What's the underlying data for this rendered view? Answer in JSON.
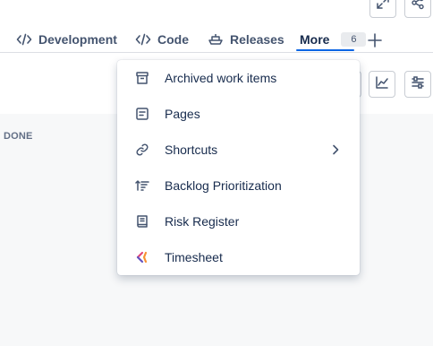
{
  "header": {
    "expand_icon": "expand-icon",
    "share_icon": "share-icon"
  },
  "tabs": [
    {
      "label": "Development",
      "icon": "code-slash-icon"
    },
    {
      "label": "Code",
      "icon": "code-slash-icon"
    },
    {
      "label": "Releases",
      "icon": "ship-icon"
    },
    {
      "label": "More",
      "badge": "6",
      "active": true
    }
  ],
  "add_tab_icon": "plus-icon",
  "toolbar": {
    "chart_icon": "line-chart-icon",
    "settings_icon": "sliders-icon"
  },
  "board": {
    "column_title": "DONE"
  },
  "menu": {
    "items": [
      {
        "label": "Archived work items",
        "icon": "archive-icon"
      },
      {
        "label": "Pages",
        "icon": "page-icon"
      },
      {
        "label": "Shortcuts",
        "icon": "link-icon",
        "has_submenu": true
      },
      {
        "label": "Backlog Prioritization",
        "icon": "sort-priority-icon"
      },
      {
        "label": "Risk Register",
        "icon": "book-icon"
      },
      {
        "label": "Timesheet",
        "icon": "timesheet-app-icon"
      }
    ]
  },
  "colors": {
    "accent": "#0c66e4",
    "text": "#172b4d",
    "subtle_text": "#44546f",
    "board_bg": "#f7f8f9",
    "timesheet_pink": "#e2487a",
    "timesheet_orange": "#f79233",
    "timesheet_purple": "#6554c0"
  }
}
